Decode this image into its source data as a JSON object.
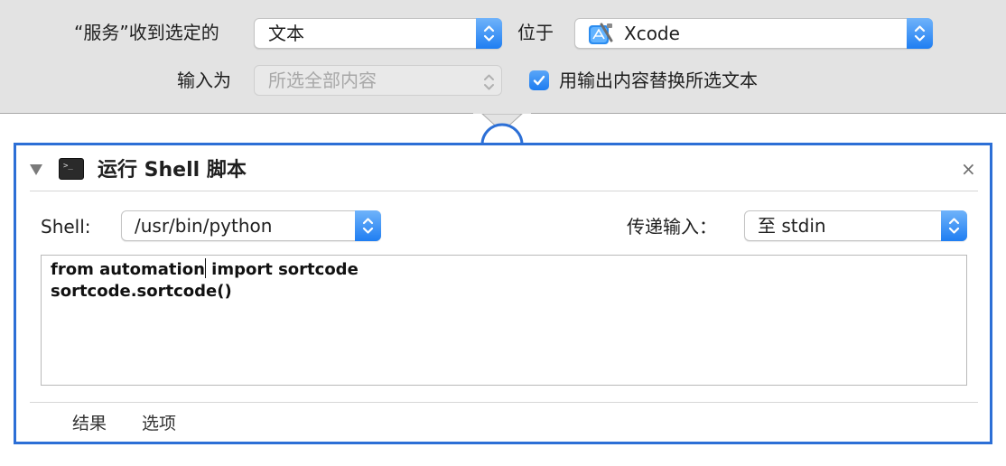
{
  "top": {
    "service_receives_label": "“服务”收到选定的",
    "input_type_value": "文本",
    "in_label": "位于",
    "app_value": "Xcode",
    "input_is_label": "输入为",
    "input_is_value": "所选全部内容",
    "replace_checkbox_label": "用输出内容替换所选文本",
    "replace_checked": true
  },
  "action": {
    "title": "运行 Shell 脚本",
    "close_symbol": "×",
    "shell_label": "Shell:",
    "shell_value": "/usr/bin/python",
    "pass_input_label": "传递输入：",
    "pass_input_value": "至 stdin",
    "script_line1_a": "from automation",
    "script_line1_b": " import sortcode",
    "script_line2": "sortcode.sortcode()",
    "tabs": [
      "结果",
      "选项"
    ]
  },
  "colors": {
    "accent_blue": "#2c6fd6",
    "band_gray": "#e3e3e3"
  }
}
